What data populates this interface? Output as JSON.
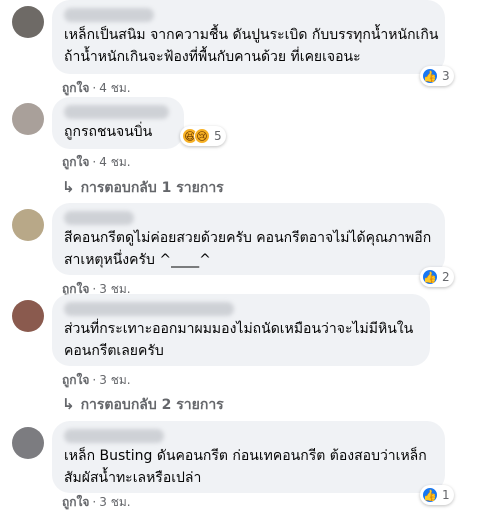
{
  "comments": [
    {
      "text_lines": [
        "เหล็กเป็นสนิม จากความชื้น ดันปูนระเบิด กับบรรทุกน้ำหนักเกิน",
        "ถ้าน้ำหนักเกินจะฟ้องที่พื้นกับคานด้วย ที่เคยเจอนะ"
      ],
      "like_label": "ถูกใจ",
      "time": "4 ชม.",
      "reaction_count": "3"
    },
    {
      "text_lines": [
        "ถูกรถชนจนบิ่น"
      ],
      "like_label": "ถูกใจ",
      "time": "4 ชม.",
      "reaction_count": "5",
      "replies_label": "การตอบกลับ 1 รายการ"
    },
    {
      "text_lines": [
        "สีคอนกรีตดูไม่ค่อยสวยด้วยครับ คอนกรีตอาจไม่ได้คุณภาพอีก",
        "สาเหตุหนึ่งครับ ^____^"
      ],
      "like_label": "ถูกใจ",
      "time": "3 ชม.",
      "reaction_count": "2"
    },
    {
      "text_lines": [
        "ส่วนที่กระเทาะออกมาผมมองไม่ถนัดเหมือนว่าจะไม่มีหินใน",
        "คอนกรีตเลยครับ"
      ],
      "like_label": "ถูกใจ",
      "time": "3 ชม.",
      "replies_label": "การตอบกลับ 2 รายการ"
    },
    {
      "text_lines": [
        "เหล็ก Busting ดันคอนกรีต ก่อนเทคอนกรีต ต้องสอบว่าเหล็ก",
        "สัมผัสน้ำทะเลหรือเปล่า"
      ],
      "like_label": "ถูกใจ",
      "time": "3 ชม.",
      "reaction_count": "1"
    }
  ],
  "separator": "·",
  "colors": {
    "bubble": "#f0f2f5",
    "meta": "#65676b",
    "like_blue": "#1877f2"
  },
  "icons": {
    "like": "thumbs-up-icon",
    "haha": "haha-emoji-icon",
    "sad": "sad-emoji-icon",
    "reply_arrow": "reply-arrow-icon"
  }
}
